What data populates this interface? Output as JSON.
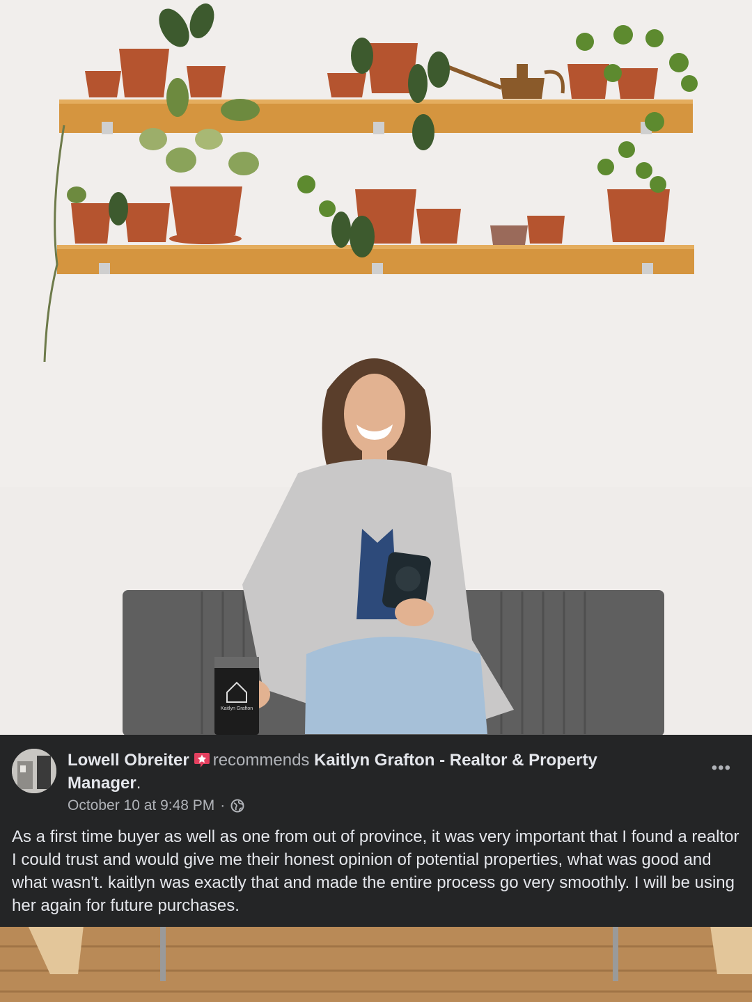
{
  "post": {
    "author": "Lowell Obreiter",
    "recommends_word": "recommends",
    "page_name": "Kaitlyn Grafton - Realtor & Property Manager",
    "period": ".",
    "timestamp": "October 10 at 9:48 PM",
    "separator": "·",
    "privacy_icon": "globe-icon",
    "badge_icon": "recommend-star-badge-icon",
    "more_icon": "more-options-icon",
    "more_label": "•••",
    "body": "As a first time buyer as well as one from out of province,  it was very important that I found a realtor I could trust and would give me their honest opinion of potential properties,  what was good and what wasn't. kaitlyn was exactly that and made the entire process go very smoothly.  I will be using her again for future purchases."
  },
  "photo": {
    "mug_text": "Kaitlyn Grafton"
  },
  "colors": {
    "card_bg": "#242526",
    "primary_text": "#e4e6eb",
    "secondary_text": "#b0b3b8",
    "badge": "#e4405f"
  }
}
